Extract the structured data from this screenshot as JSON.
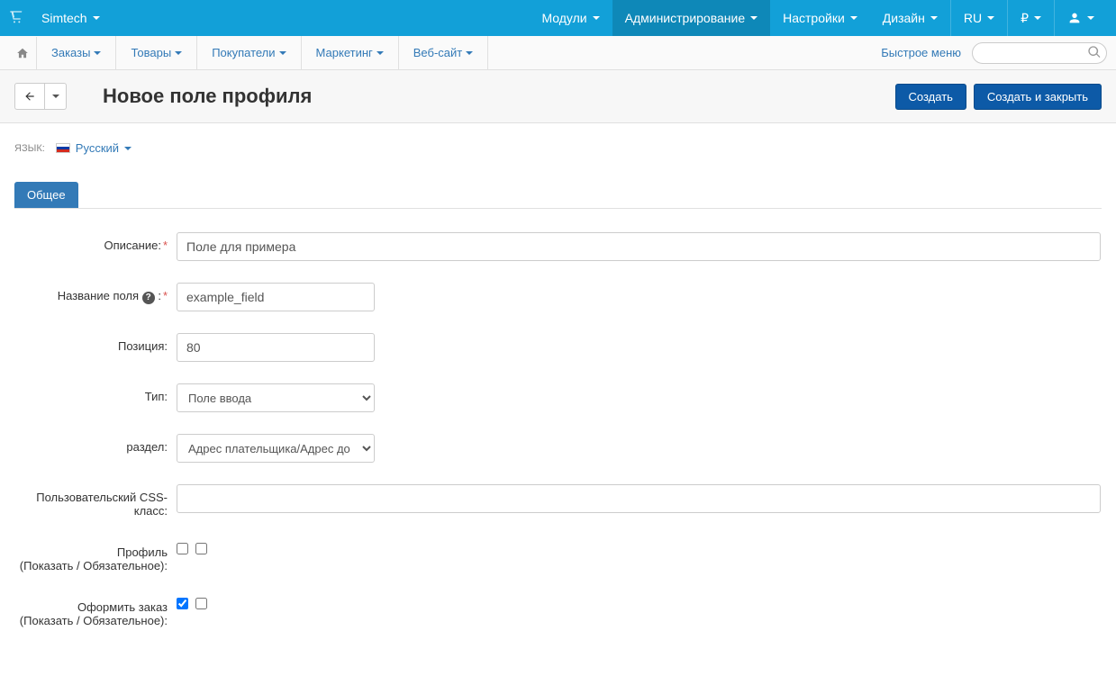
{
  "topbar": {
    "brand": "Simtech",
    "nav": [
      {
        "label": "Модули"
      },
      {
        "label": "Администрирование",
        "active": true
      },
      {
        "label": "Настройки"
      },
      {
        "label": "Дизайн"
      }
    ],
    "lang": "RU",
    "currency": "₽"
  },
  "subnav": {
    "items": [
      {
        "label": "Заказы"
      },
      {
        "label": "Товары"
      },
      {
        "label": "Покупатели"
      },
      {
        "label": "Маркетинг"
      },
      {
        "label": "Веб-сайт"
      }
    ],
    "quickmenu": "Быстрое меню"
  },
  "titlebar": {
    "title": "Новое поле профиля",
    "create": "Создать",
    "create_close": "Создать и закрыть"
  },
  "lang_section": {
    "label": "язык:",
    "lang_name": "Русский"
  },
  "tabs": {
    "general": "Общее"
  },
  "form": {
    "description": {
      "label": "Описание:",
      "value": "Поле для примера"
    },
    "field_name": {
      "label": "Название поля",
      "value": "example_field"
    },
    "position": {
      "label": "Позиция:",
      "value": "80"
    },
    "type": {
      "label": "Тип:",
      "value": "Поле ввода"
    },
    "section": {
      "label": "раздел:",
      "value": "Адрес плательщика/Адрес до"
    },
    "css_class": {
      "label": "Пользовательский CSS-класс:",
      "value": ""
    },
    "profile": {
      "label": "Профиль",
      "sublabel": "(Показать / Обязательное):",
      "show": false,
      "required": false
    },
    "checkout": {
      "label": "Оформить заказ",
      "sublabel": "(Показать / Обязательное):",
      "show": true,
      "required": false
    }
  }
}
